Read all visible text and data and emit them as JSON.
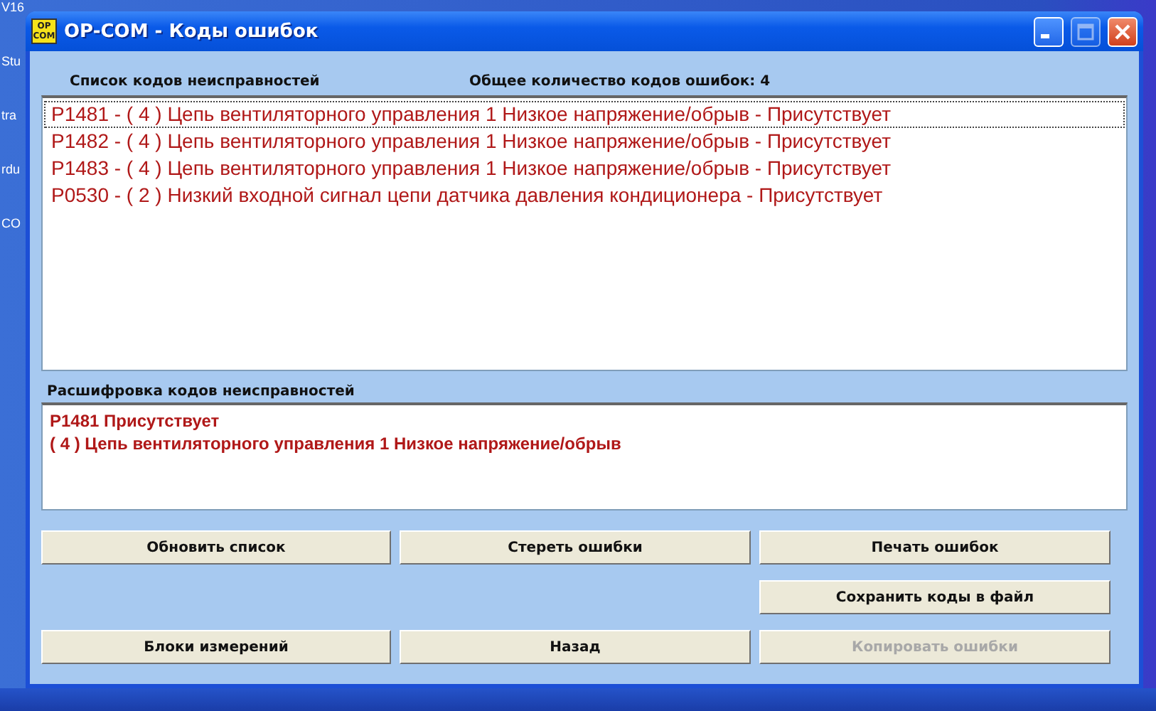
{
  "desktop": {
    "icon_labels": [
      "V16",
      "Stu",
      "tra",
      "rdu",
      "CO"
    ]
  },
  "window": {
    "title": "OP-COM - Коды ошибок",
    "app_icon_text": [
      "OP",
      "COM"
    ]
  },
  "fault_list": {
    "label": "Список кодов неисправностей",
    "total_label": "Общее количество кодов ошибок:",
    "total": "4",
    "items": [
      {
        "text": "P1481 - ( 4 )  Цепь вентиляторного управления 1 Низкое напряжение/обрыв  - Присутствует",
        "selected": true
      },
      {
        "text": "P1482 - ( 4 )  Цепь вентиляторного управления 1 Низкое напряжение/обрыв  - Присутствует",
        "selected": false
      },
      {
        "text": "P1483 - ( 4 )  Цепь вентиляторного управления 1 Низкое напряжение/обрыв  - Присутствует",
        "selected": false
      },
      {
        "text": "P0530 - ( 2 )  Низкий входной сигнал цепи датчика давления кондиционера  - Присутствует",
        "selected": false
      }
    ]
  },
  "decode": {
    "label": "Расшифровка кодов неисправностей",
    "lines": [
      "P1481  Присутствует",
      "( 4 )  Цепь вентиляторного управления 1 Низкое напряжение/обрыв"
    ]
  },
  "button_rows": [
    [
      {
        "label": "Обновить список",
        "disabled": false
      },
      {
        "label": "Стереть ошибки",
        "disabled": false
      },
      {
        "label": "Печать ошибок",
        "disabled": false
      }
    ],
    [
      {
        "label": "Сохранить коды в файл",
        "disabled": false
      }
    ],
    [
      {
        "label": "Блоки измерений",
        "disabled": false
      },
      {
        "label": "Назад",
        "disabled": false
      },
      {
        "label": "Копировать ошибки",
        "disabled": true
      }
    ]
  ]
}
